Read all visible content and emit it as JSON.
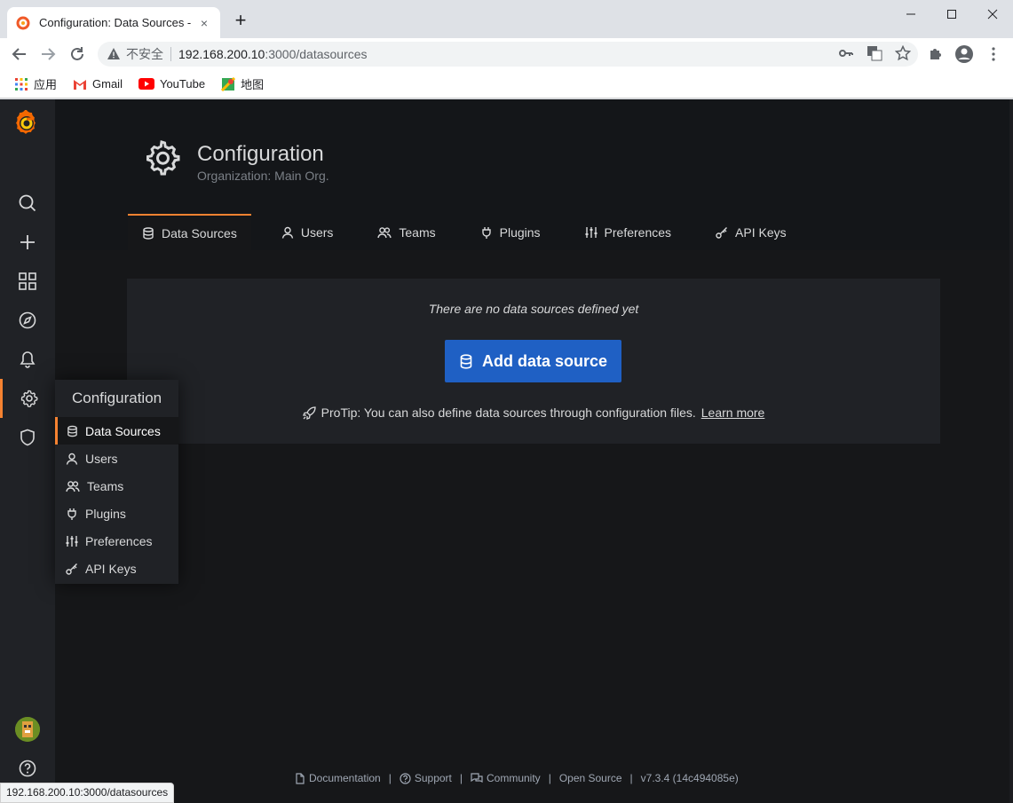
{
  "browser": {
    "tab_title": "Configuration: Data Sources -",
    "close_glyph": "×",
    "newtab_glyph": "+",
    "insecure_label": "不安全",
    "url_host": "192.168.200.10",
    "url_path": ":3000/datasources",
    "bookmarks": [
      {
        "label": "应用",
        "icon": "apps-grid-icon"
      },
      {
        "label": "Gmail",
        "icon": "gmail-icon"
      },
      {
        "label": "YouTube",
        "icon": "youtube-icon"
      },
      {
        "label": "地图",
        "icon": "maps-icon"
      }
    ],
    "status_url": "192.168.200.10:3000/datasources"
  },
  "header": {
    "title": "Configuration",
    "subtitle": "Organization: Main Org."
  },
  "tabs": [
    {
      "label": "Data Sources",
      "icon": "database-icon",
      "active": true
    },
    {
      "label": "Users",
      "icon": "user-icon",
      "active": false
    },
    {
      "label": "Teams",
      "icon": "users-icon",
      "active": false
    },
    {
      "label": "Plugins",
      "icon": "plug-icon",
      "active": false
    },
    {
      "label": "Preferences",
      "icon": "sliders-icon",
      "active": false
    },
    {
      "label": "API Keys",
      "icon": "key-icon",
      "active": false
    }
  ],
  "empty": {
    "message": "There are no data sources defined yet",
    "button_label": "Add data source",
    "protip": "ProTip: You can also define data sources through configuration files.",
    "learn_more": "Learn more"
  },
  "flyout": {
    "title": "Configuration",
    "items": [
      {
        "label": "Data Sources",
        "icon": "database-icon",
        "active": true
      },
      {
        "label": "Users",
        "icon": "user-icon",
        "active": false
      },
      {
        "label": "Teams",
        "icon": "users-icon",
        "active": false
      },
      {
        "label": "Plugins",
        "icon": "plug-icon",
        "active": false
      },
      {
        "label": "Preferences",
        "icon": "sliders-icon",
        "active": false
      },
      {
        "label": "API Keys",
        "icon": "key-icon",
        "active": false
      }
    ]
  },
  "footer": {
    "documentation": "Documentation",
    "support": "Support",
    "community": "Community",
    "open_source": "Open Source",
    "version": "v7.3.4 (14c494085e)",
    "separator": "|"
  },
  "colors": {
    "accent": "#f58231",
    "primary_button": "#1f60c4",
    "sidebar_bg": "#202226",
    "page_bg": "#161719"
  }
}
